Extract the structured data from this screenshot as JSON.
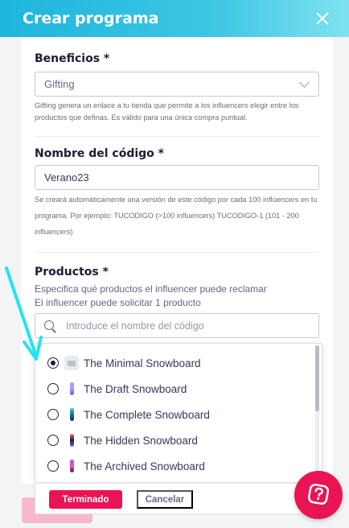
{
  "header": {
    "title": "Crear programa"
  },
  "benefits": {
    "label": "Beneficios *",
    "selected": "Gifting",
    "help": "Gifting genera un enlace a tu tienda que permite a los influencers elegir entre los productos que definas. Es válido para una única compra puntual."
  },
  "code": {
    "label": "Nombre del código *",
    "value": "Verano23",
    "help": "Se creará automáticamente una versión de este código por cada 100 influencers en tu programa. Por ejemplo: TUCODIGO (>100 influencers) TUCODIGO-1 (101 - 200 influencers)"
  },
  "products": {
    "label": "Productos *",
    "desc1": "Especifica qué productos el influencer puede reclamar",
    "desc2": "El influencer puede solicitar 1 producto",
    "search_placeholder": "Introduce el nombre del código",
    "options": [
      {
        "label": "The Minimal Snowboard",
        "checked": true,
        "icon": "image-placeholder-icon"
      },
      {
        "label": "The Draft Snowboard",
        "checked": false,
        "icon": "snowboard-icon"
      },
      {
        "label": "The Complete Snowboard",
        "checked": false,
        "icon": "snowboard-icon"
      },
      {
        "label": "The Hidden Snowboard",
        "checked": false,
        "icon": "snowboard-icon"
      },
      {
        "label": "The Archived Snowboard",
        "checked": false,
        "icon": "snowboard-icon"
      }
    ],
    "done_label": "Terminado",
    "cancel_label": "Cancelar"
  },
  "colors": {
    "header_start": "#1fb5dc",
    "accent": "#ea1455",
    "annotation_arrow": "#25e3ee"
  }
}
